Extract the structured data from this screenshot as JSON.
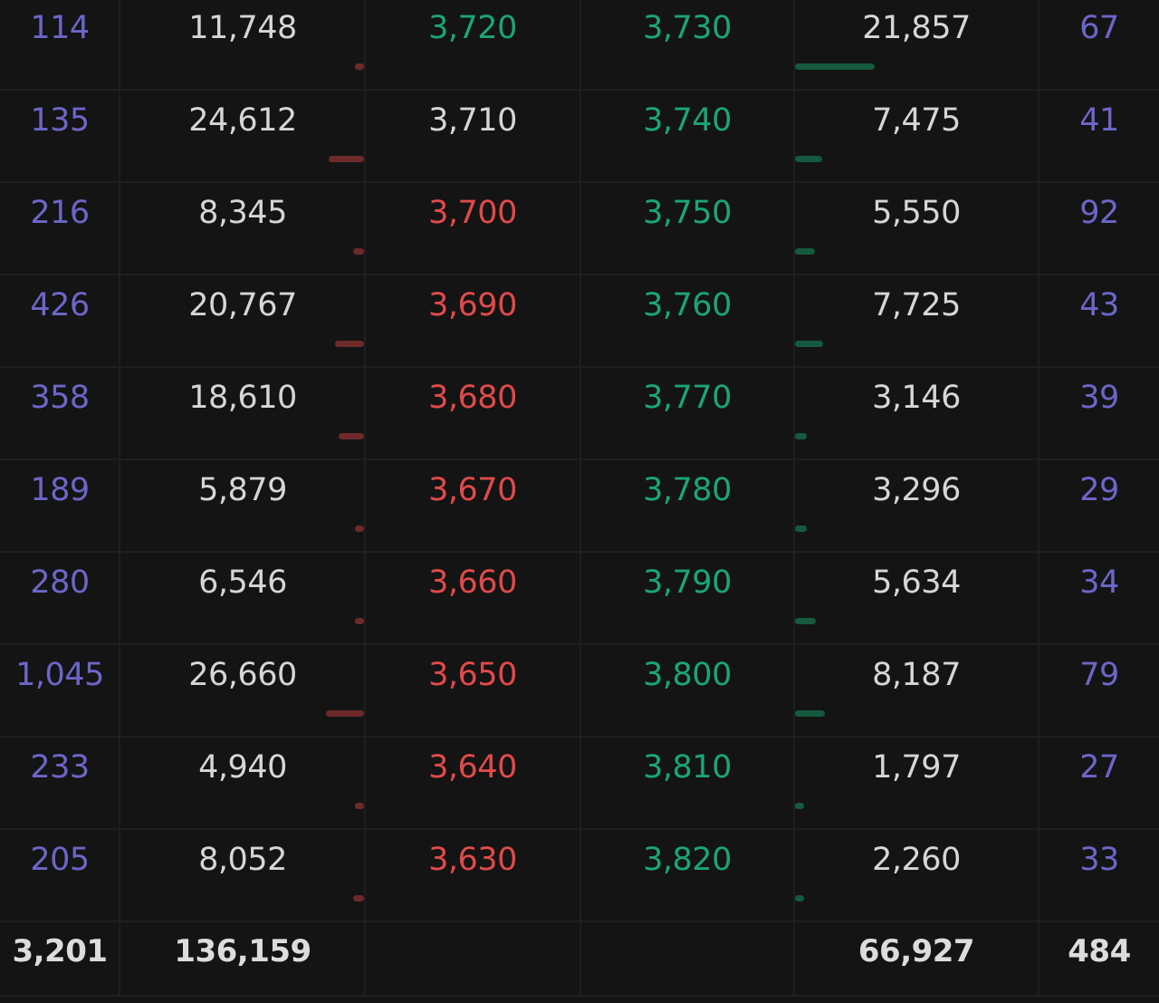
{
  "order_book": {
    "rows": [
      {
        "bid_count": "114",
        "bid_qty": "11,748",
        "bid_price": "3,720",
        "bid_price_color": "green",
        "ask_price": "3,730",
        "ask_qty": "21,857",
        "ask_count": "67",
        "bid_depth_ratio": 0.0851,
        "ask_depth_ratio": 1.0
      },
      {
        "bid_count": "135",
        "bid_qty": "24,612",
        "bid_price": "3,710",
        "bid_price_color": "neutral",
        "ask_price": "3,740",
        "ask_qty": "7,475",
        "ask_count": "41",
        "bid_depth_ratio": 0.55,
        "ask_depth_ratio": 0.341
      },
      {
        "bid_count": "216",
        "bid_qty": "8,345",
        "bid_price": "3,700",
        "bid_price_color": "red",
        "ask_price": "3,750",
        "ask_qty": "5,550",
        "ask_count": "92",
        "bid_depth_ratio": 0.17,
        "ask_depth_ratio": 0.25
      },
      {
        "bid_count": "426",
        "bid_qty": "20,767",
        "bid_price": "3,690",
        "bid_price_color": "red",
        "ask_price": "3,760",
        "ask_qty": "7,725",
        "ask_count": "43",
        "bid_depth_ratio": 0.45,
        "ask_depth_ratio": 0.35
      },
      {
        "bid_count": "358",
        "bid_qty": "18,610",
        "bid_price": "3,680",
        "bid_price_color": "red",
        "ask_price": "3,770",
        "ask_qty": "3,146",
        "ask_count": "39",
        "bid_depth_ratio": 0.4,
        "ask_depth_ratio": 0.15
      },
      {
        "bid_count": "189",
        "bid_qty": "5,879",
        "bid_price": "3,670",
        "bid_price_color": "red",
        "ask_price": "3,780",
        "ask_qty": "3,296",
        "ask_count": "29",
        "bid_depth_ratio": 0.11,
        "ask_depth_ratio": 0.15
      },
      {
        "bid_count": "280",
        "bid_qty": "6,546",
        "bid_price": "3,660",
        "bid_price_color": "red",
        "ask_price": "3,790",
        "ask_qty": "5,634",
        "ask_count": "34",
        "bid_depth_ratio": 0.13,
        "ask_depth_ratio": 0.26
      },
      {
        "bid_count": "1,045",
        "bid_qty": "26,660",
        "bid_price": "3,650",
        "bid_price_color": "red",
        "ask_price": "3,800",
        "ask_qty": "8,187",
        "ask_count": "79",
        "bid_depth_ratio": 0.6,
        "ask_depth_ratio": 0.37
      },
      {
        "bid_count": "233",
        "bid_qty": "4,940",
        "bid_price": "3,640",
        "bid_price_color": "red",
        "ask_price": "3,810",
        "ask_qty": "1,797",
        "ask_count": "27",
        "bid_depth_ratio": 0.1,
        "ask_depth_ratio": 0.09
      },
      {
        "bid_count": "205",
        "bid_qty": "8,052",
        "bid_price": "3,630",
        "bid_price_color": "red",
        "ask_price": "3,820",
        "ask_qty": "2,260",
        "ask_count": "33",
        "bid_depth_ratio": 0.17,
        "ask_depth_ratio": 0.1
      }
    ],
    "totals": {
      "bid_count": "3,201",
      "bid_qty": "136,159",
      "bid_price": "",
      "ask_price": "",
      "ask_qty": "66,927",
      "ask_count": "484"
    },
    "colors": {
      "background": "#141414",
      "count": "#6c66c9",
      "qty": "#d6d6d6",
      "bid_price_red": "#e14a4a",
      "ask_price_green": "#1aa57a",
      "bid_depth_bar": "#6e2a2a",
      "ask_depth_bar": "#155a3e"
    }
  }
}
